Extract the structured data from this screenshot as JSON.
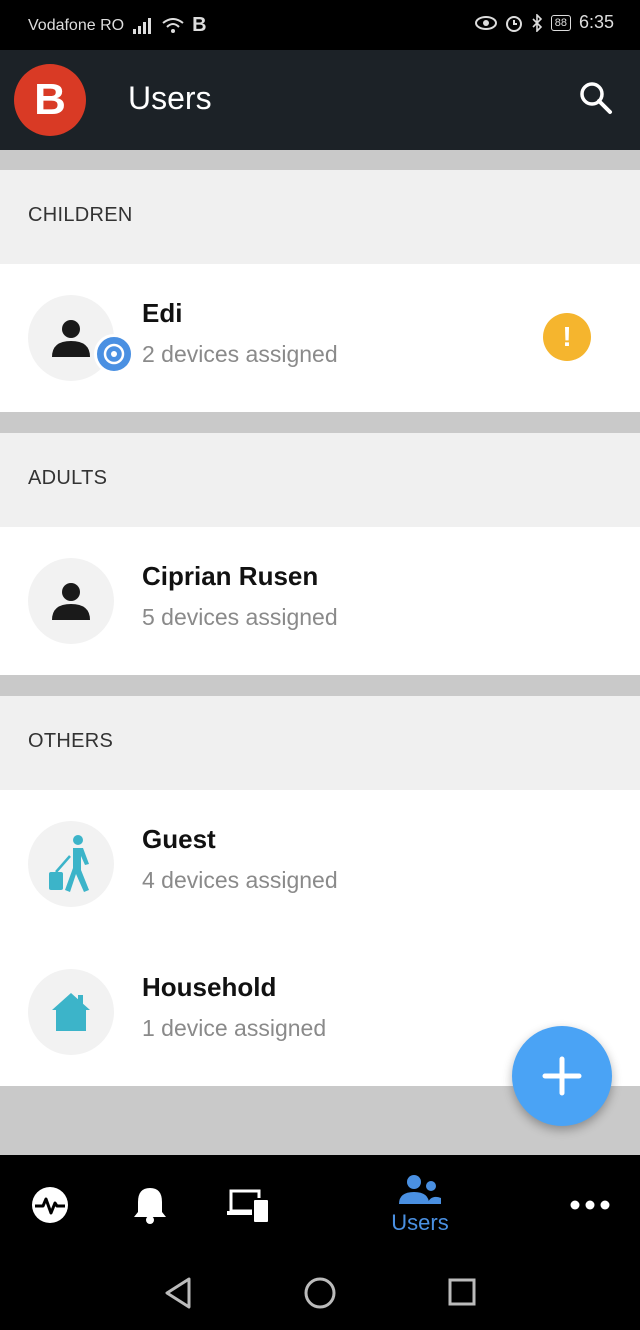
{
  "status": {
    "carrier": "Vodafone RO",
    "carrier_icon": "B",
    "battery": "88",
    "time": "6:35"
  },
  "app_bar": {
    "logo": "B",
    "title": "Users"
  },
  "sections": [
    {
      "header": "CHILDREN",
      "users": [
        {
          "name": "Edi",
          "devices": "2 devices assigned",
          "warning": "!"
        }
      ]
    },
    {
      "header": "ADULTS",
      "users": [
        {
          "name": "Ciprian Rusen",
          "devices": "5 devices assigned"
        }
      ]
    },
    {
      "header": "OTHERS",
      "users": [
        {
          "name": "Guest",
          "devices": "4 devices assigned"
        },
        {
          "name": "Household",
          "devices": "1 device assigned"
        }
      ]
    }
  ],
  "nav": {
    "users_label": "Users"
  },
  "colors": {
    "accent": "#4a90e2",
    "warning": "#f5b52e",
    "brand": "#d93a25",
    "guest_icon": "#3cb4c9"
  },
  "icons": [
    "search-icon",
    "person-icon",
    "child-badge-icon",
    "warning-icon",
    "guest-icon",
    "home-icon",
    "plus-icon",
    "activity-icon",
    "bell-icon",
    "devices-icon",
    "users-icon",
    "more-icon",
    "back-icon",
    "home-circle-icon",
    "recents-icon"
  ]
}
